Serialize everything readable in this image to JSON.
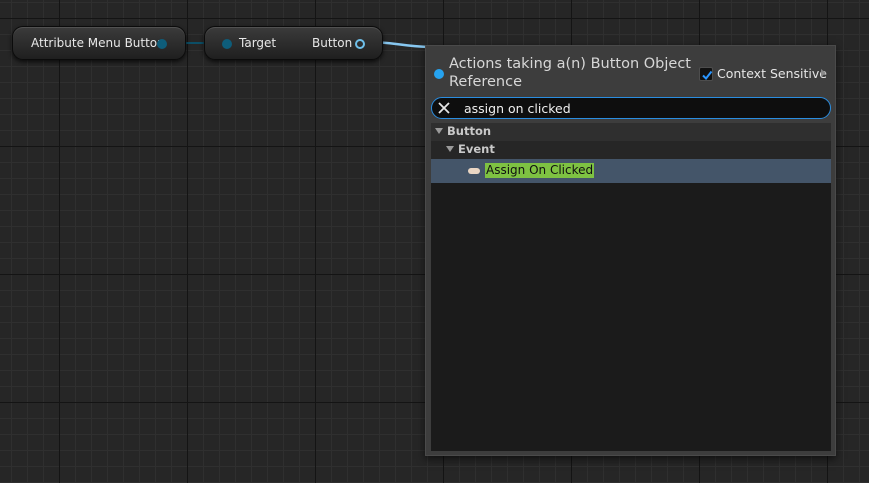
{
  "nodes": {
    "attribute_menu_button": {
      "label": "Attribute Menu Button"
    },
    "get_node": {
      "target_label": "Target",
      "button_label": "Button"
    }
  },
  "menu": {
    "title": "Actions taking a(n) Button Object Reference",
    "context_sensitive_label": "Context Sensitive",
    "context_sensitive_checked": true,
    "search": {
      "value": "assign on clicked",
      "placeholder": ""
    },
    "tree": {
      "category": "Button",
      "subcategory": "Event",
      "action": "Assign On Clicked"
    }
  },
  "colors": {
    "object_pin": "#26a3f0",
    "highlight": "#7ec242",
    "search_border": "#2a8de0",
    "selected_row": "#445569"
  },
  "icons": [
    "close-icon",
    "checkmark-icon",
    "expand-arrow-icon",
    "collapse-arrow-icon",
    "event-pill-icon"
  ]
}
